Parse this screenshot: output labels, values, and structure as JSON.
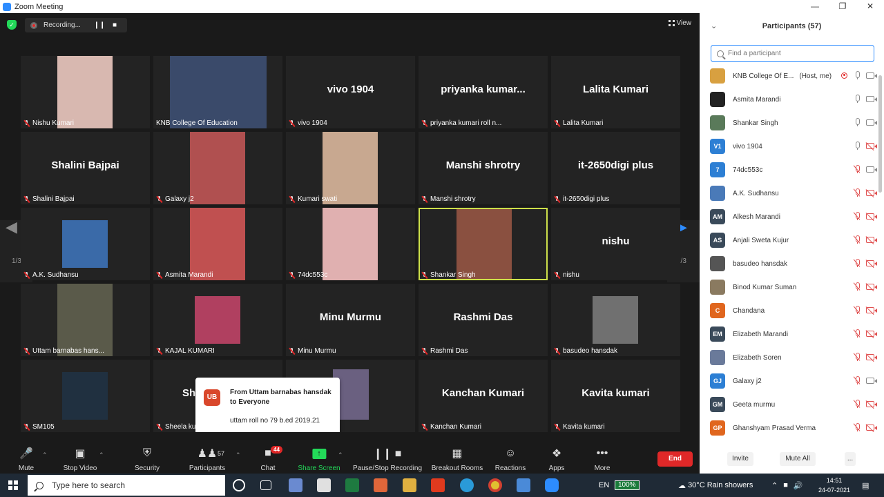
{
  "window": {
    "title": "Zoom Meeting"
  },
  "topbar": {
    "recording_label": "Recording...",
    "view_label": "View"
  },
  "pager": {
    "left": "1/3",
    "right": "1/3"
  },
  "tiles": [
    {
      "label": "Nishu Kumari",
      "big": "",
      "photo": "#d8b8b0"
    },
    {
      "label": "KNB College Of Education",
      "big": "",
      "photo": "#3a4a6a"
    },
    {
      "label": "vivo 1904",
      "big": "vivo 1904",
      "photo": ""
    },
    {
      "label": "priyanka kumari roll n...",
      "big": "priyanka  kumar...",
      "photo": ""
    },
    {
      "label": "Lalita Kumari",
      "big": "Lalita Kumari",
      "photo": ""
    },
    {
      "label": "Shalini Bajpai",
      "big": "Shalini Bajpai",
      "photo": ""
    },
    {
      "label": "Galaxy j2",
      "big": "",
      "photo": "#b05050"
    },
    {
      "label": "Kumari swati",
      "big": "",
      "photo": "#c8a890"
    },
    {
      "label": "Manshi shrotry",
      "big": "Manshi shrotry",
      "photo": ""
    },
    {
      "label": "it-2650digi plus",
      "big": "it-2650digi plus",
      "photo": ""
    },
    {
      "label": "A.K. Sudhansu",
      "big": "",
      "photo": "#3a6aa8"
    },
    {
      "label": "Asmita Marandi",
      "big": "",
      "photo": "#c05050"
    },
    {
      "label": "74dc553c",
      "big": "",
      "photo": "#e0b0b0"
    },
    {
      "label": "Shankar Singh",
      "big": "",
      "photo": "#8a5040"
    },
    {
      "label": "nishu",
      "big": "nishu",
      "photo": ""
    },
    {
      "label": "Uttam barnabas hans...",
      "big": "",
      "photo": "#5a5a4a"
    },
    {
      "label": "KAJAL KUMARI",
      "big": "",
      "photo": "#b04060"
    },
    {
      "label": "Minu Murmu",
      "big": "Minu Murmu",
      "photo": ""
    },
    {
      "label": "Rashmi Das",
      "big": "Rashmi Das",
      "photo": ""
    },
    {
      "label": "basudeo hansdak",
      "big": "",
      "photo": "#707070"
    },
    {
      "label": "SM105",
      "big": "",
      "photo": "#203040"
    },
    {
      "label": "Sheela ku",
      "big": "Sh",
      "photo": ""
    },
    {
      "label": "ri",
      "big": "",
      "photo": "#6a6080"
    },
    {
      "label": "Kanchan Kumari",
      "big": "Kanchan Kumari",
      "photo": ""
    },
    {
      "label": "Kavita kumari",
      "big": "Kavita kumari",
      "photo": ""
    }
  ],
  "toast": {
    "initials": "UB",
    "from": "From Uttam barnabas hansdak to Everyone",
    "message": "uttam roll no 79 b.ed 2019.21"
  },
  "toolbar": {
    "mute": "Mute",
    "stop_video": "Stop Video",
    "security": "Security",
    "participants": "Participants",
    "participants_count": "57",
    "chat": "Chat",
    "chat_badge": "44",
    "share_screen": "Share Screen",
    "recording": "Pause/Stop Recording",
    "breakout": "Breakout Rooms",
    "reactions": "Reactions",
    "apps": "Apps",
    "more": "More",
    "end": "End"
  },
  "panel": {
    "title": "Participants (57)",
    "search_placeholder": "Find a participant",
    "participants": [
      {
        "name": "KNB College Of E...",
        "suffix": "(Host, me)",
        "initials": "",
        "color": "#d8a040",
        "mic": "on",
        "cam": "on",
        "rec": true
      },
      {
        "name": "Asmita Marandi",
        "suffix": "",
        "initials": "",
        "color": "#222222",
        "mic": "on",
        "cam": "on",
        "rec": false
      },
      {
        "name": "Shankar Singh",
        "suffix": "",
        "initials": "",
        "color": "#5a7a5a",
        "mic": "on",
        "cam": "on",
        "rec": false
      },
      {
        "name": "vivo 1904",
        "suffix": "",
        "initials": "V1",
        "color": "#2d7fd4",
        "mic": "on",
        "cam": "off",
        "rec": false
      },
      {
        "name": "74dc553c",
        "suffix": "",
        "initials": "7",
        "color": "#2d7fd4",
        "mic": "off",
        "cam": "on",
        "rec": false
      },
      {
        "name": "A.K. Sudhansu",
        "suffix": "",
        "initials": "",
        "color": "#4a7ab8",
        "mic": "off",
        "cam": "off",
        "rec": false
      },
      {
        "name": "Alkesh Marandi",
        "suffix": "",
        "initials": "AM",
        "color": "#3a4a5a",
        "mic": "off",
        "cam": "off",
        "rec": false
      },
      {
        "name": "Anjali Sweta Kujur",
        "suffix": "",
        "initials": "AS",
        "color": "#3a4a5a",
        "mic": "off",
        "cam": "off",
        "rec": false
      },
      {
        "name": "basudeo hansdak",
        "suffix": "",
        "initials": "",
        "color": "#555555",
        "mic": "off",
        "cam": "off",
        "rec": false
      },
      {
        "name": "Binod Kumar Suman",
        "suffix": "",
        "initials": "",
        "color": "#8a7a60",
        "mic": "off",
        "cam": "off",
        "rec": false
      },
      {
        "name": "Chandana",
        "suffix": "",
        "initials": "C",
        "color": "#e0661e",
        "mic": "off",
        "cam": "off",
        "rec": false
      },
      {
        "name": "Elizabeth Marandi",
        "suffix": "",
        "initials": "EM",
        "color": "#3a4a5a",
        "mic": "off",
        "cam": "off",
        "rec": false
      },
      {
        "name": "Elizabeth Soren",
        "suffix": "",
        "initials": "",
        "color": "#6a7a9a",
        "mic": "off",
        "cam": "off",
        "rec": false
      },
      {
        "name": "Galaxy j2",
        "suffix": "",
        "initials": "GJ",
        "color": "#2d7fd4",
        "mic": "off",
        "cam": "on",
        "rec": false
      },
      {
        "name": "Geeta murmu",
        "suffix": "",
        "initials": "GM",
        "color": "#3a4a5a",
        "mic": "off",
        "cam": "off",
        "rec": false
      },
      {
        "name": "Ghanshyam Prasad Verma",
        "suffix": "",
        "initials": "GP",
        "color": "#e0661e",
        "mic": "off",
        "cam": "off",
        "rec": false
      }
    ],
    "invite": "Invite",
    "mute_all": "Mute All",
    "more": "..."
  },
  "taskbar": {
    "search_placeholder": "Type here to search",
    "lang": "EN",
    "battery": "100%",
    "weather": "30°C  Rain showers",
    "time": "14:51",
    "date": "24-07-2021"
  }
}
